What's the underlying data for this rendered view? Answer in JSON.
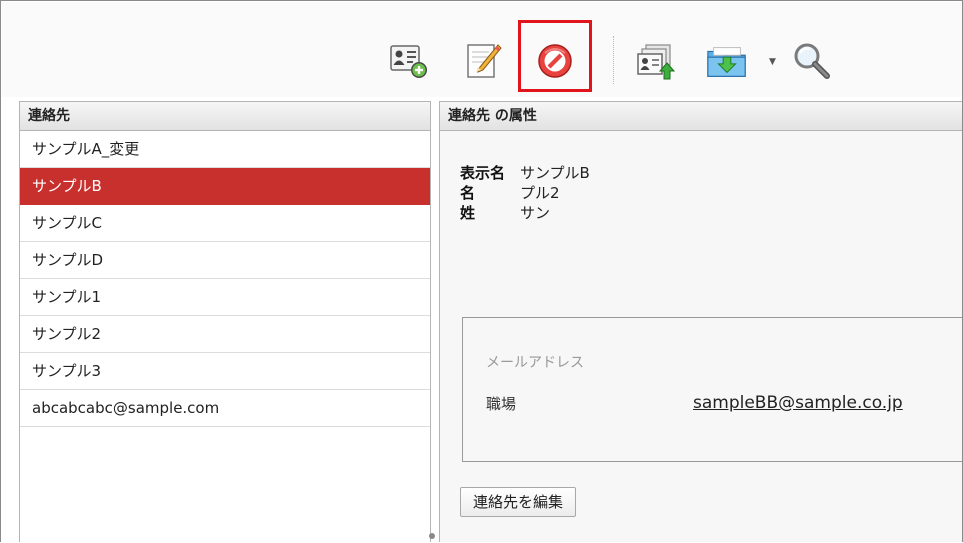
{
  "toolbar": {
    "buttons": [
      {
        "name": "new-contact",
        "icon": "contact-card-add-icon"
      },
      {
        "name": "edit-contact",
        "icon": "edit-pencil-icon"
      },
      {
        "name": "delete-contact",
        "icon": "prohibited-icon",
        "highlighted": true
      },
      {
        "name": "export-contacts",
        "icon": "contacts-export-icon"
      },
      {
        "name": "import-contacts",
        "icon": "folder-import-icon",
        "has_dropdown": true
      },
      {
        "name": "search",
        "icon": "magnifier-icon"
      }
    ],
    "highlight_color": "#e0141a"
  },
  "contacts_panel": {
    "title": "連絡先",
    "items": [
      {
        "label": "サンプルA_変更"
      },
      {
        "label": "サンプルB",
        "selected": true
      },
      {
        "label": "サンプルC"
      },
      {
        "label": "サンプルD"
      },
      {
        "label": "サンプル1"
      },
      {
        "label": "サンプル2"
      },
      {
        "label": "サンプル3"
      },
      {
        "label": "abcabcabc@sample.com"
      }
    ],
    "selected_color": "#c8302e"
  },
  "attributes_panel": {
    "title": "連絡先 の属性",
    "fields": [
      {
        "key": "表示名",
        "value": "サンプルB"
      },
      {
        "key": "名",
        "value": "プル2"
      },
      {
        "key": "姓",
        "value": "サン"
      }
    ],
    "email_section": {
      "title": "メールアドレス",
      "type": "職場",
      "address": "sampleBB@sample.co.jp"
    },
    "edit_button_label": "連絡先を編集"
  }
}
